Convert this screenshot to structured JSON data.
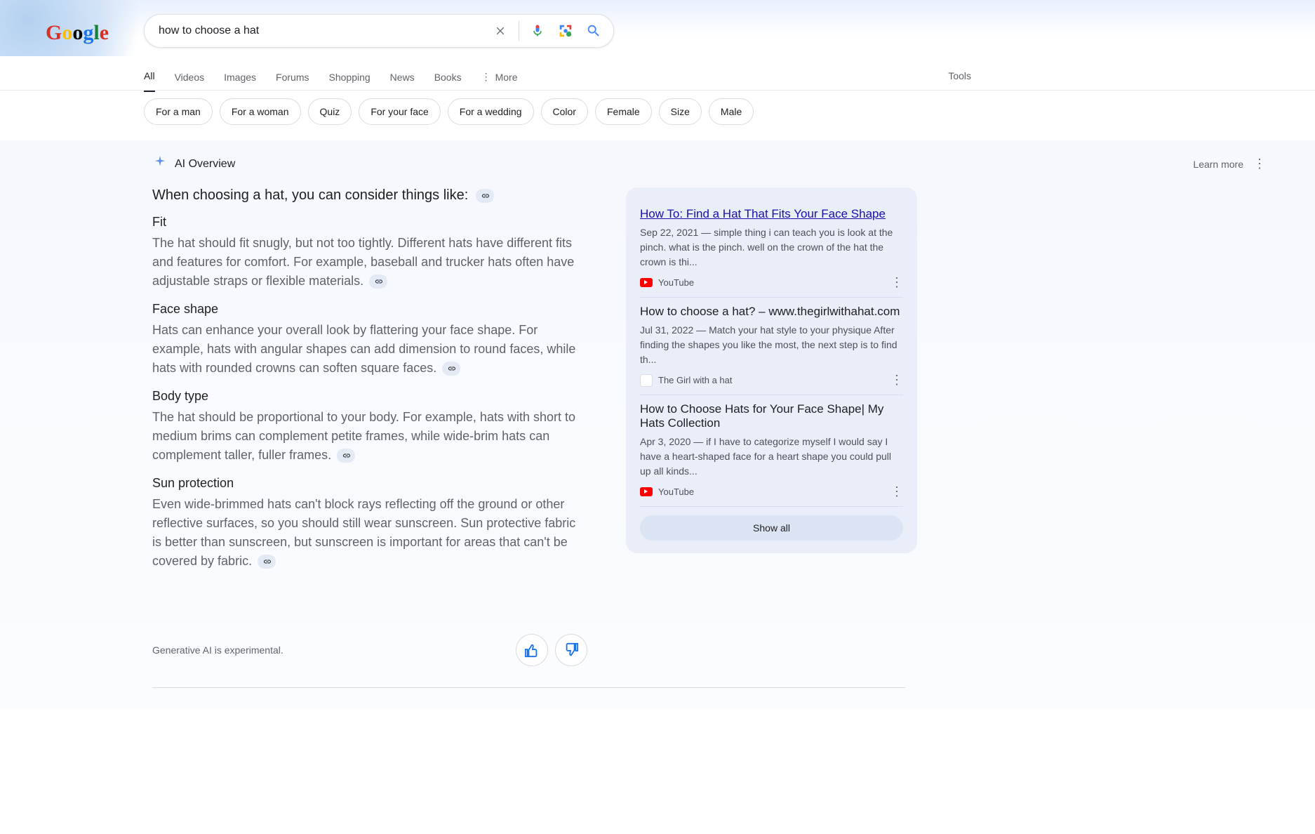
{
  "search": {
    "query": "how to choose a hat"
  },
  "nav": {
    "items": [
      "All",
      "Videos",
      "Images",
      "Forums",
      "Shopping",
      "News",
      "Books"
    ],
    "more": "More",
    "tools": "Tools"
  },
  "chips": [
    "For a man",
    "For a woman",
    "Quiz",
    "For your face",
    "For a wedding",
    "Color",
    "Female",
    "Size",
    "Male"
  ],
  "ai": {
    "label": "AI Overview",
    "learn_more": "Learn more",
    "intro": "When choosing a hat, you can consider things like:",
    "sections": [
      {
        "title": "Fit",
        "body": "The hat should fit snugly, but not too tightly. Different hats have different fits and features for comfort. For example, baseball and trucker hats often have adjustable straps or flexible materials."
      },
      {
        "title": "Face shape",
        "body": "Hats can enhance your overall look by flattering your face shape. For example, hats with angular shapes can add dimension to round faces, while hats with rounded crowns can soften square faces."
      },
      {
        "title": "Body type",
        "body": "The hat should be proportional to your body. For example, hats with short to medium brims can complement petite frames, while wide-brim hats can complement taller, fuller frames."
      },
      {
        "title": "Sun protection",
        "body": "Even wide-brimmed hats can't block rays reflecting off the ground or other reflective surfaces, so you should still wear sunscreen. Sun protective fabric is better than sunscreen, but sunscreen is important for areas that can't be covered by fabric."
      }
    ],
    "disclaimer": "Generative AI is experimental."
  },
  "sources": [
    {
      "title": "How To: Find a Hat That Fits Your Face Shape",
      "date": "Sep 22, 2021",
      "snippet": "simple thing i can teach you is look at the pinch. what is the pinch. well on the crown of the hat the crown is thi...",
      "site": "YouTube",
      "icon": "youtube"
    },
    {
      "title": "How to choose a hat? – www.thegirlwithahat.com",
      "date": "Jul 31, 2022",
      "snippet": "Match your hat style to your physique After finding the shapes you like the most, the next step is to find th...",
      "site": "The Girl with a hat",
      "icon": "generic"
    },
    {
      "title": "How to Choose Hats for Your Face Shape| My Hats Collection",
      "date": "Apr 3, 2020",
      "snippet": "if I have to categorize myself I would say I have a heart-shaped face for a heart shape you could pull up all kinds...",
      "site": "YouTube",
      "icon": "youtube"
    }
  ],
  "show_all": "Show all"
}
